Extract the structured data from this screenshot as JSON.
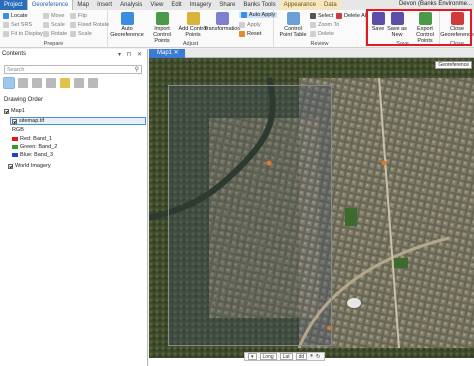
{
  "tabs": [
    "Project",
    "Georeference",
    "Map",
    "Insert",
    "Analysis",
    "View",
    "Edit",
    "Imagery",
    "Share",
    "Banks Tools",
    "Appearance",
    "Data"
  ],
  "user": "Devon (Banks Environme...",
  "ribbon": {
    "prepare": {
      "label": "Prepare",
      "locate": "Locate",
      "set_srs": "Set SRS",
      "fit_display": "Fit to Display",
      "move": "Move",
      "scale": "Scale",
      "rotate": "Rotate",
      "flip": "Flip",
      "fixed_rotate": "Fixed Rotate",
      "fixed_scale": "Scale"
    },
    "adjust": {
      "label": "Adjust",
      "auto_georef": "Auto Georeference",
      "import_cp": "Import Control Points",
      "add_cp": "Add Control Points",
      "transformation": "Transformation",
      "auto_apply": "Auto Apply",
      "apply": "Apply",
      "reset": "Reset"
    },
    "review": {
      "label": "Review",
      "cp_table": "Control Point Table",
      "select": "Select",
      "zoom_to": "Zoom To",
      "delete": "Delete",
      "delete_all": "Delete All"
    },
    "save": {
      "label": "Save",
      "save": "Save",
      "save_as_new": "Save as New",
      "export_cp": "Export Control Points"
    },
    "close": {
      "label": "Close",
      "close_georef": "Close Georeference"
    }
  },
  "contents": {
    "title": "Contents",
    "search_placeholder": "Search",
    "drawing_order": "Drawing Order",
    "map_name": "Map1",
    "layer": "sitemap.tif",
    "rgb": "RGB",
    "bands": [
      {
        "label": "Red:  Band_1",
        "color": "#e31a1c"
      },
      {
        "label": "Green: Band_2",
        "color": "#33a02c"
      },
      {
        "label": "Blue:  Band_3",
        "color": "#1f3fd6"
      }
    ],
    "basemap": "World Imagery"
  },
  "map": {
    "tab": "Map1",
    "label": "Georeference",
    "status": {
      "long": "Long",
      "lat": "Lat",
      "dd": "dd"
    }
  },
  "colors": {
    "accent": "#2a6ebb",
    "highlight": "#e01b24"
  }
}
